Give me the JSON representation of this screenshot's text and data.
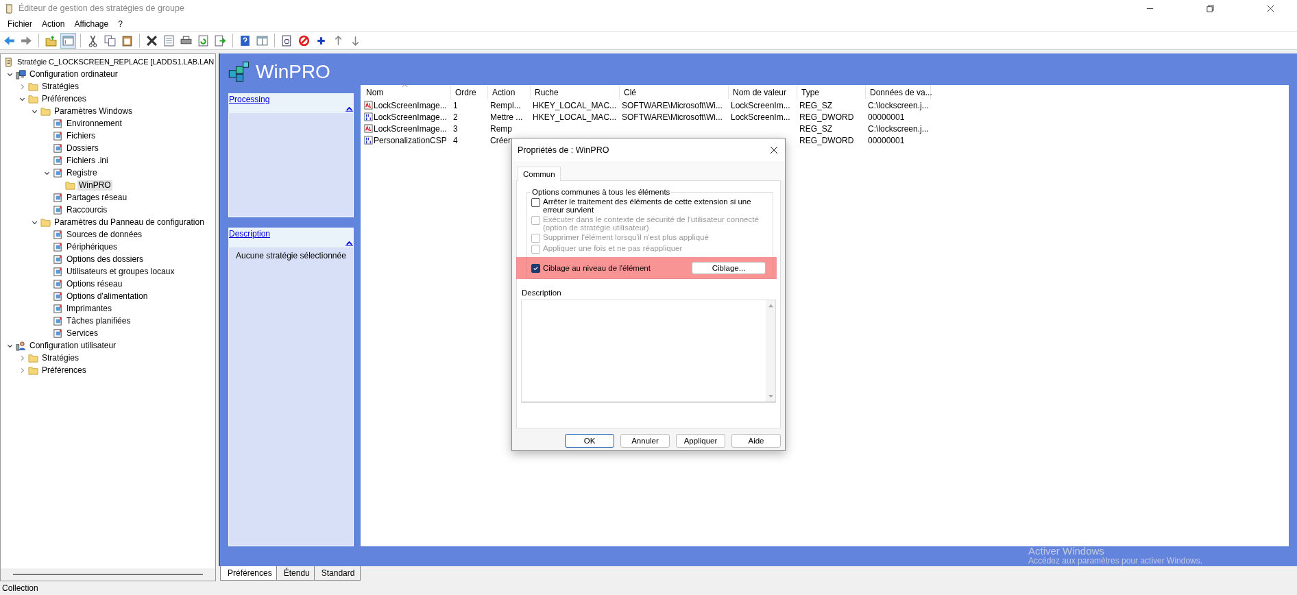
{
  "window": {
    "title": "Éditeur de gestion des stratégies de groupe"
  },
  "menu": [
    "Fichier",
    "Action",
    "Affichage",
    "?"
  ],
  "tree": [
    {
      "label": "Stratégie C_LOCKSCREEN_REPLACE [LADDS1.LAB.LAN",
      "kind": "policy",
      "selected": false,
      "children": [
        {
          "label": "Configuration ordinateur",
          "kind": "computer",
          "expanded": true,
          "selected": false,
          "children": [
            {
              "label": "Stratégies",
              "kind": "folder",
              "expanded": false,
              "selected": false
            },
            {
              "label": "Préférences",
              "kind": "folder",
              "expanded": true,
              "selected": false,
              "children": [
                {
                  "label": "Paramètres Windows",
                  "kind": "folder",
                  "expanded": true,
                  "selected": false,
                  "children": [
                    {
                      "label": "Environnement",
                      "kind": "item",
                      "selected": false
                    },
                    {
                      "label": "Fichiers",
                      "kind": "item",
                      "selected": false
                    },
                    {
                      "label": "Dossiers",
                      "kind": "item",
                      "selected": false
                    },
                    {
                      "label": "Fichiers .ini",
                      "kind": "item",
                      "selected": false
                    },
                    {
                      "label": "Registre",
                      "kind": "item",
                      "expanded": true,
                      "selected": false,
                      "children": [
                        {
                          "label": "WinPRO",
                          "kind": "folder",
                          "selected": true
                        }
                      ]
                    },
                    {
                      "label": "Partages réseau",
                      "kind": "item",
                      "selected": false
                    },
                    {
                      "label": "Raccourcis",
                      "kind": "item",
                      "selected": false
                    }
                  ]
                },
                {
                  "label": "Paramètres du Panneau de configuration",
                  "kind": "folder",
                  "expanded": true,
                  "selected": false,
                  "children": [
                    {
                      "label": "Sources de données",
                      "kind": "item",
                      "selected": false
                    },
                    {
                      "label": "Périphériques",
                      "kind": "item",
                      "selected": false
                    },
                    {
                      "label": "Options des dossiers",
                      "kind": "item",
                      "selected": false
                    },
                    {
                      "label": "Utilisateurs et groupes locaux",
                      "kind": "item",
                      "selected": false
                    },
                    {
                      "label": "Options réseau",
                      "kind": "item",
                      "selected": false
                    },
                    {
                      "label": "Options d'alimentation",
                      "kind": "item",
                      "selected": false
                    },
                    {
                      "label": "Imprimantes",
                      "kind": "item",
                      "selected": false
                    },
                    {
                      "label": "Tâches planifiées",
                      "kind": "item",
                      "selected": false
                    },
                    {
                      "label": "Services",
                      "kind": "item",
                      "selected": false
                    }
                  ]
                }
              ]
            }
          ]
        },
        {
          "label": "Configuration utilisateur",
          "kind": "user",
          "expanded": true,
          "selected": false,
          "children": [
            {
              "label": "Stratégies",
              "kind": "folder",
              "expanded": false,
              "selected": false
            },
            {
              "label": "Préférences",
              "kind": "folder",
              "expanded": false,
              "selected": false
            }
          ]
        }
      ]
    }
  ],
  "details": {
    "title": "WinPRO",
    "panels": [
      {
        "title": "Processing"
      },
      {
        "title": "Description",
        "body": "Aucune stratégie sélectionnée"
      }
    ]
  },
  "table": {
    "columns": [
      {
        "label": "Nom",
        "sorted": true
      },
      {
        "label": "Ordre",
        "sorted": false
      },
      {
        "label": "Action",
        "sorted": false
      },
      {
        "label": "Ruche",
        "sorted": false
      },
      {
        "label": "Clé",
        "sorted": false
      },
      {
        "label": "Nom de valeur",
        "sorted": false
      },
      {
        "label": "Type",
        "sorted": false
      },
      {
        "label": "Données de va...",
        "sorted": false
      }
    ],
    "rows": [
      {
        "kind": "string",
        "cells": [
          "LockScreenImage...",
          "1",
          "Rempl...",
          "HKEY_LOCAL_MAC...",
          "SOFTWARE\\Microsoft\\Wi...",
          "LockScreenIm...",
          "REG_SZ",
          "C:\\lockscreen.j..."
        ]
      },
      {
        "kind": "dword",
        "cells": [
          "LockScreenImage...",
          "2",
          "Mettre ...",
          "HKEY_LOCAL_MAC...",
          "SOFTWARE\\Microsoft\\Wi...",
          "LockScreenIm...",
          "REG_DWORD",
          "00000001"
        ]
      },
      {
        "kind": "string",
        "cells": [
          "LockScreenImage...",
          "3",
          "Remp",
          null,
          null,
          null,
          "REG_SZ",
          "C:\\lockscreen.j..."
        ]
      },
      {
        "kind": "dword",
        "cells": [
          "PersonalizationCSP",
          "4",
          "Créer",
          null,
          null,
          null,
          "REG_DWORD",
          "00000001"
        ]
      }
    ]
  },
  "dialog": {
    "title": "Propriétés de : WinPRO",
    "tabs": [
      {
        "label": "Commun",
        "selected": true
      }
    ],
    "group_title": "Options communes à tous les éléments",
    "options": [
      {
        "label": "Arrêter le traitement des éléments de cette extension si une erreur survient",
        "checked": false,
        "disabled": false,
        "highlighted": false
      },
      {
        "label": "Exécuter dans le contexte de sécurité de l'utilisateur connecté (option de stratégie utilisateur)",
        "checked": false,
        "disabled": true,
        "highlighted": false
      },
      {
        "label": "Supprimer l'élément lorsqu'il n'est plus appliqué",
        "checked": false,
        "disabled": true,
        "highlighted": false
      },
      {
        "label": "Appliquer une fois et ne pas réappliquer",
        "checked": false,
        "disabled": true,
        "highlighted": false
      },
      {
        "label": "Ciblage au niveau de l'élément",
        "checked": true,
        "disabled": false,
        "highlighted": true,
        "button": "Ciblage..."
      }
    ],
    "description_label": "Description",
    "buttons": [
      {
        "label": "OK",
        "default": true
      },
      {
        "label": "Annuler",
        "default": false
      },
      {
        "label": "Appliquer",
        "default": false
      },
      {
        "label": "Aide",
        "default": false
      }
    ]
  },
  "bottom_tabs": [
    {
      "label": "Préférences",
      "selected": true
    },
    {
      "label": "Étendu",
      "selected": false
    },
    {
      "label": "Standard",
      "selected": false
    }
  ],
  "activation_notice": {
    "title": "Activer Windows",
    "text": "Accédez aux paramètres pour activer Windows."
  },
  "status_bar": "Collection"
}
